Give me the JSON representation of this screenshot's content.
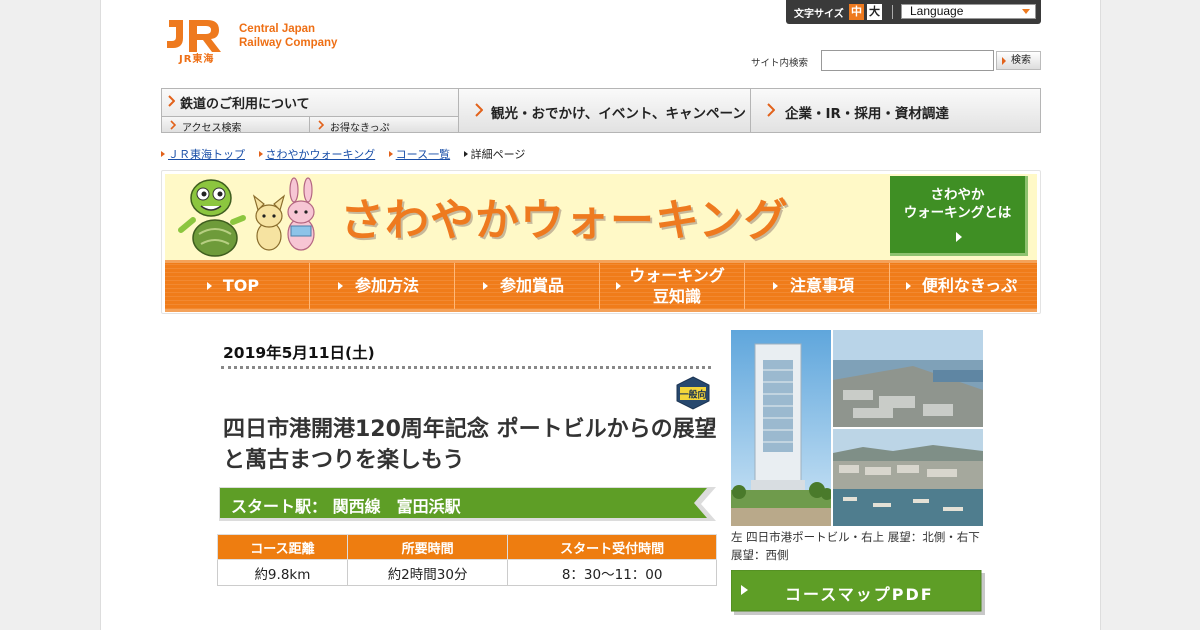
{
  "header": {
    "logo_small": "JR東海",
    "logo_en_line1": "Central Japan",
    "logo_en_line2": "Railway Company",
    "font_size_label": "文字サイズ",
    "font_size_mid": "中",
    "font_size_big": "大",
    "language_label": "Language",
    "search_label": "サイト内検索",
    "search_value": "",
    "search_button": "検索"
  },
  "gnav": {
    "item1": "鉄道のご利用について",
    "item1_sub1": "アクセス検索",
    "item1_sub2": "お得なきっぷ",
    "item2": "観光・おでかけ、イベント、キャンペーン",
    "item3": "企業・IR・採用・資材調達"
  },
  "breadcrumb": {
    "b1": "ＪＲ東海トップ",
    "b2": "さわやかウォーキング",
    "b3": "コース一覧",
    "b4": "詳細ページ"
  },
  "banner": {
    "title": "さわやかウォーキング",
    "about_line1": "さわやか",
    "about_line2": "ウォーキングとは",
    "nav": {
      "top": "TOP",
      "howto": "参加方法",
      "prize": "参加賞品",
      "tips_line1": "ウォーキング",
      "tips_line2": "豆知識",
      "notes": "注意事項",
      "tickets": "便利なきっぷ"
    }
  },
  "detail": {
    "date": "2019年5月11日(土)",
    "badge": "一般向",
    "title": "四日市港開港120周年記念 ポートビルからの展望と萬古まつりを楽しもう",
    "start_station": "スタート駅： 関西線　富田浜駅",
    "table": {
      "headers": [
        "コース距離",
        "所要時間",
        "スタート受付時間"
      ],
      "values": [
        "約9.8km",
        "約2時間30分",
        "8：30～11：00"
      ]
    },
    "photo_caption": "左 四日市港ポートビル・右上 展望：北側・右下 展望：西側",
    "pdf_button": "コースマップPDF"
  },
  "colors": {
    "jr_orange": "#ee7a1f",
    "table_orange": "#ee7d10",
    "green": "#5e9e26",
    "link_blue": "#1a4fa8"
  }
}
